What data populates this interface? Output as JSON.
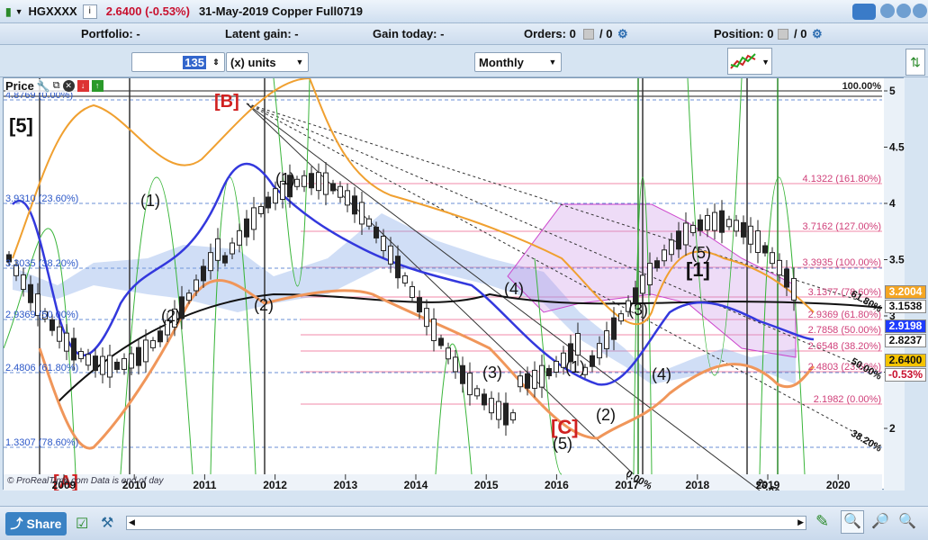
{
  "header": {
    "symbol": "HGXXXX",
    "price": "2.6400 (-0.53%)",
    "description": "31-May-2019 Copper Full0719"
  },
  "infobar": {
    "portfolio": "Portfolio: -",
    "latent_gain": "Latent gain: -",
    "gain_today": "Gain today: -",
    "orders": "Orders: 0",
    "orders_slash": "/ 0",
    "position": "Position: 0",
    "position_slash": "/ 0"
  },
  "toolbar": {
    "units_value": "135",
    "units_label": "(x) units",
    "timeframe": "Monthly"
  },
  "chart": {
    "panel_label": "Price",
    "watermark": "© ProRealTime.com  Data is end of day",
    "x_ticks": [
      "2009",
      "2010",
      "2011",
      "2012",
      "2013",
      "2014",
      "2015",
      "2016",
      "2017",
      "2018",
      "2019",
      "2020"
    ],
    "y_ticks": [
      "5",
      "4.5",
      "4",
      "3.5",
      "3",
      "2.5",
      "2"
    ],
    "left_fib_labels": [
      "4.8769 (0.00%)",
      "3.9310 (23.60%)",
      "3.3035 (38.20%)",
      "2.9369 (50.00%)",
      "2.4806 (61.80%)",
      "1.3307 (78.60%)"
    ],
    "right_fib_labels": [
      "100.00%",
      "4.1322 (161.80%)",
      "3.7162 (127.00%)",
      "3.3935 (100.00%)",
      "3.1377 (78.60%)",
      "2.9369 (61.80%)",
      "2.7858 (50.00%)",
      "2.6548 (38.20%)",
      "2.4803 (23.60%)",
      "2.1982 (0.00%)"
    ],
    "fan_labels": [
      "61.80%",
      "50.00%",
      "38.20%",
      "23.60%",
      "0.00%"
    ],
    "wave_labels": [
      "[5]",
      "[A]",
      "[B]",
      "[C]",
      "[1]",
      "(1)",
      "(2)",
      "(1)",
      "(2)",
      "(3)",
      "(4)",
      "(1)",
      "(2)",
      "(5)",
      "(3)",
      "(4)",
      "(5)"
    ],
    "price_badges": [
      {
        "value": "3.2004",
        "color": "#f5a623"
      },
      {
        "value": "3.1538",
        "color": "#ffffff"
      },
      {
        "value": "2.9198",
        "color": "#1e3cff"
      },
      {
        "value": "2.8237",
        "color": "#ffffff"
      },
      {
        "value": "2.6400",
        "color": "#f5c400"
      },
      {
        "value": "-0.53%",
        "color": "#ffffff"
      }
    ]
  },
  "bottom": {
    "share_label": "Share"
  }
}
